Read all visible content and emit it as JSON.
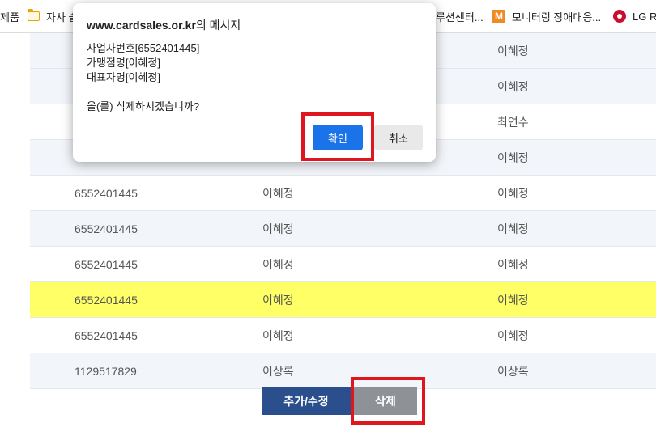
{
  "bookmarks": [
    {
      "label": "제품",
      "icon": "none"
    },
    {
      "label": "자사 솔",
      "icon": "folder-icon"
    },
    {
      "label": "루션센터...",
      "icon": "none"
    },
    {
      "label": "모니터링 장애대응...",
      "icon": "m-logo-icon"
    },
    {
      "label": "LG Re",
      "icon": "lg-logo-icon"
    }
  ],
  "table": {
    "rows": [
      {
        "business_no": "",
        "store_name": "",
        "representative": "이혜정"
      },
      {
        "business_no": "",
        "store_name": "",
        "representative": "이혜정"
      },
      {
        "business_no": "",
        "store_name": "",
        "representative": "최연수"
      },
      {
        "business_no": "",
        "store_name": "",
        "representative": "이혜정"
      },
      {
        "business_no": "6552401445",
        "store_name": "이혜정",
        "representative": "이혜정"
      },
      {
        "business_no": "6552401445",
        "store_name": "이혜정",
        "representative": "이혜정"
      },
      {
        "business_no": "6552401445",
        "store_name": "이혜정",
        "representative": "이혜정"
      },
      {
        "business_no": "6552401445",
        "store_name": "이혜정",
        "representative": "이혜정"
      },
      {
        "business_no": "6552401445",
        "store_name": "이혜정",
        "representative": "이혜정"
      },
      {
        "business_no": "1129517829",
        "store_name": "이상록",
        "representative": "이상록"
      }
    ]
  },
  "actions": {
    "add_edit_label": "추가/수정",
    "delete_label": "삭제"
  },
  "dialog": {
    "origin": "www.cardsales.or.kr",
    "title_suffix": "의 메시지",
    "lines": [
      "사업자번호[6552401445]",
      "가맹점명[이혜정]",
      "대표자명[이혜정]"
    ],
    "question": "을(를) 삭제하시겠습니까?",
    "ok_label": "확인",
    "cancel_label": "취소"
  },
  "colors": {
    "highlight_box": "#e0161e",
    "selected_row": "#ffff66",
    "primary_button": "#2a4f8c",
    "delete_button": "#8e9196",
    "dialog_ok": "#1a73e8"
  }
}
